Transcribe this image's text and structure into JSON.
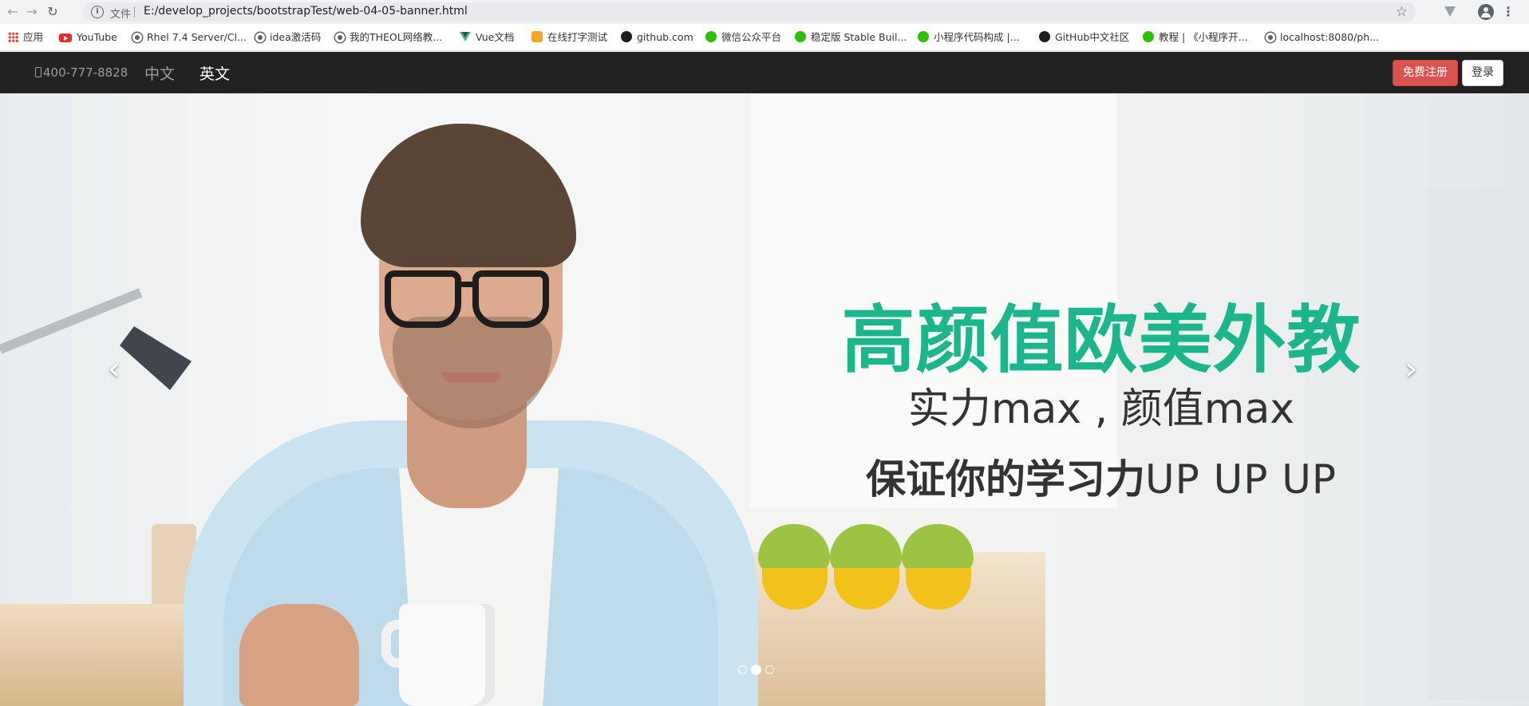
{
  "browser": {
    "file_label": "文件",
    "url": "E:/develop_projects/bootstrapTest/web-04-05-banner.html",
    "bookmarks": [
      {
        "label": "应用",
        "icon": "apps-icon"
      },
      {
        "label": "YouTube",
        "icon": "youtube-icon"
      },
      {
        "label": "Rhel 7.4 Server/Cl...",
        "icon": "globe-icon"
      },
      {
        "label": "idea激活码",
        "icon": "globe-icon"
      },
      {
        "label": "我的THEOL网络教...",
        "icon": "globe-icon"
      },
      {
        "label": "Vue文档",
        "icon": "vue-icon"
      },
      {
        "label": "在线打字测试",
        "icon": "dog-icon"
      },
      {
        "label": "github.com",
        "icon": "github-icon"
      },
      {
        "label": "微信公众平台",
        "icon": "wechat-icon"
      },
      {
        "label": "稳定版 Stable Buil...",
        "icon": "wechat-icon"
      },
      {
        "label": "小程序代码构成 |...",
        "icon": "wechat-icon"
      },
      {
        "label": "GitHub中文社区",
        "icon": "github-icon"
      },
      {
        "label": "教程 | 《小程序开...",
        "icon": "wechat-icon"
      },
      {
        "label": "localhost:8080/ph...",
        "icon": "globe-icon"
      }
    ]
  },
  "navbar": {
    "phone": "400-777-8828",
    "lang_cn": "中文",
    "lang_en": "英文",
    "register": "免费注册",
    "login": "登录"
  },
  "banner": {
    "title": "高颜值欧美外教",
    "subtitle": "实力max , 颜值max",
    "note_bold": "保证你的学习力",
    "note_up": "UP UP UP",
    "prev_icon": "‹",
    "next_icon": "›",
    "slides_count": 3,
    "active_slide": 2
  },
  "colors": {
    "navbar_bg": "#222222",
    "title_green": "#1cb68c",
    "register_red": "#d9534f"
  }
}
